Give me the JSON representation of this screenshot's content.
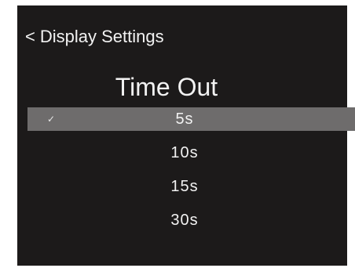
{
  "header": {
    "back_glyph": "<",
    "back_label": "Display Settings"
  },
  "title": "Time Out",
  "options": [
    {
      "label": "5s",
      "selected": true,
      "check": "✓"
    },
    {
      "label": "10s",
      "selected": false
    },
    {
      "label": "15s",
      "selected": false
    },
    {
      "label": "30s",
      "selected": false
    }
  ],
  "colors": {
    "screen_background": "#1c1a1a",
    "selected_row": "#6e6c6c",
    "text": "#f2f2f2"
  }
}
